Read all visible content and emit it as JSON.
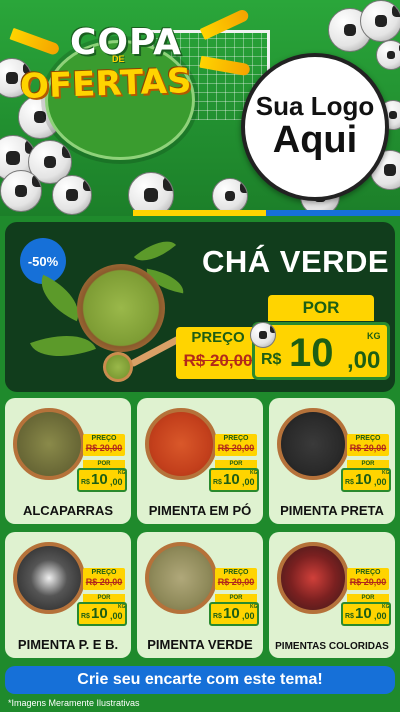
{
  "header": {
    "title_line1": "COPA",
    "title_de": "DE",
    "title_line2": "OFERTAS",
    "logo_line1": "Sua Logo",
    "logo_line2": "Aqui"
  },
  "colors": {
    "field_green": "#1f8a2c",
    "hero_dark": "#113d1c",
    "price_yellow": "#ffd400",
    "accent_blue": "#1670d8",
    "card_bg": "#dff2d0"
  },
  "hero": {
    "discount": "-50%",
    "title": "CHÁ VERDE",
    "por_label": "POR",
    "preco_label": "PREÇO",
    "old_price": "R$ 20,00",
    "currency": "R$",
    "price_int": "10",
    "price_dec": ",00",
    "unit": "KG"
  },
  "products": [
    {
      "name": "ALCAPARRAS",
      "preco_label": "PREÇO",
      "old_price": "R$ 20,00",
      "por_label": "POR",
      "currency": "R$",
      "price_int": "10",
      "price_dec": ",00",
      "unit": "KG"
    },
    {
      "name": "PIMENTA EM PÓ",
      "preco_label": "PREÇO",
      "old_price": "R$ 20,00",
      "por_label": "POR",
      "currency": "R$",
      "price_int": "10",
      "price_dec": ",00",
      "unit": "KG"
    },
    {
      "name": "PIMENTA PRETA",
      "preco_label": "PREÇO",
      "old_price": "R$ 20,00",
      "por_label": "POR",
      "currency": "R$",
      "price_int": "10",
      "price_dec": ",00",
      "unit": "KG"
    },
    {
      "name": "PIMENTA P. E B.",
      "preco_label": "PREÇO",
      "old_price": "R$ 20,00",
      "por_label": "POR",
      "currency": "R$",
      "price_int": "10",
      "price_dec": ",00",
      "unit": "KG"
    },
    {
      "name": "PIMENTA VERDE",
      "preco_label": "PREÇO",
      "old_price": "R$ 20,00",
      "por_label": "POR",
      "currency": "R$",
      "price_int": "10",
      "price_dec": ",00",
      "unit": "KG"
    },
    {
      "name": "PIMENTAS COLORIDAS",
      "preco_label": "PREÇO",
      "old_price": "R$ 20,00",
      "por_label": "POR",
      "currency": "R$",
      "price_int": "10",
      "price_dec": ",00",
      "unit": "KG"
    }
  ],
  "footer": {
    "cta": "Crie seu encarte com este tema!",
    "disclaimer": "*Imagens Meramente Ilustrativas"
  }
}
